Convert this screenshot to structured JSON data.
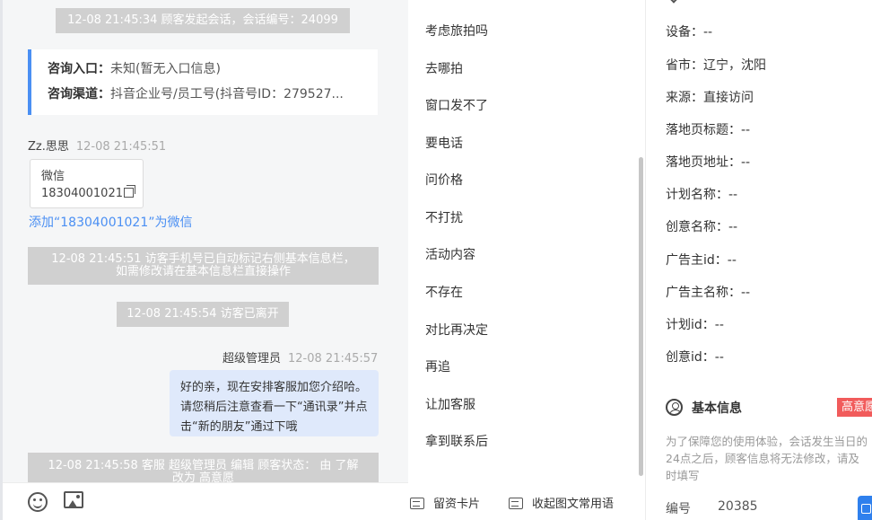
{
  "chat": {
    "session_start": "12-08 21:45:34 顾客发起会话，会话编号：24099",
    "consult_card": {
      "entry_label": "咨询入口：",
      "entry_value": "未知(暂无入口信息)",
      "channel_label": "咨询渠道：",
      "channel_value": "抖音企业号/员工号(抖音号ID：279527..."
    },
    "visitor_message": {
      "sender": "Zz.思思",
      "time": "12-08 21:45:51",
      "card_title": "微信",
      "card_number": "18304001021",
      "add_link": "添加“18304001021”为微信"
    },
    "system_auto_mark_line1": "12-08 21:45:51 访客手机号已自动标记右侧基本信息栏，",
    "system_auto_mark_line2": "如需修改请在基本信息栏直接操作",
    "system_left": "12-08 21:45:54 访客已离开",
    "agent_message": {
      "sender": "超级管理员",
      "time": "12-08 21:45:57",
      "text": "好的亲，现在安排客服加您介绍哈。请您稍后注意查看一下“通讯录”并点击“新的朋友”通过下哦"
    },
    "system_status_line1": "12-08 21:45:58 客服 超级管理员 编辑 顾客状态： 由 了解",
    "system_status_line2": "改为 高意愿"
  },
  "phrases": {
    "items": [
      "考虑旅拍吗",
      "去哪拍",
      "窗口发不了",
      "要电话",
      "问价格",
      "不打扰",
      "活动内容",
      "不存在",
      "对比再决定",
      "再追",
      "让加客服",
      "拿到联系后"
    ],
    "footer": {
      "lead_card": "留资卡片",
      "collapse": "收起图文常用语"
    }
  },
  "info": {
    "rows": [
      {
        "label": "设备：",
        "value": "--"
      },
      {
        "label": "省市：",
        "value": "辽宁，沈阳"
      },
      {
        "label": "来源：",
        "value": "直接访问"
      },
      {
        "label": "落地页标题：",
        "value": "--"
      },
      {
        "label": "落地页地址：",
        "value": "--"
      },
      {
        "label": "计划名称：",
        "value": "--"
      },
      {
        "label": "创意名称：",
        "value": "--"
      },
      {
        "label": "广告主id：",
        "value": "--"
      },
      {
        "label": "广告主名称：",
        "value": "--"
      },
      {
        "label": "计划id：",
        "value": "--"
      },
      {
        "label": "创意id：",
        "value": "--"
      }
    ],
    "basic_title": "基本信息",
    "intent_badge": "高意愿",
    "notice": "为了保障您的使用体验，会话发生当日的24点之后，顾客信息将无法修改，请及时填写",
    "serial_label": "编号",
    "serial_value": "20385"
  },
  "colors": {
    "accent": "#4a8ff3",
    "agent_bubble": "#dfe9fb",
    "system_bar": "#d0d0d0",
    "badge_red": "#f15b5b"
  }
}
